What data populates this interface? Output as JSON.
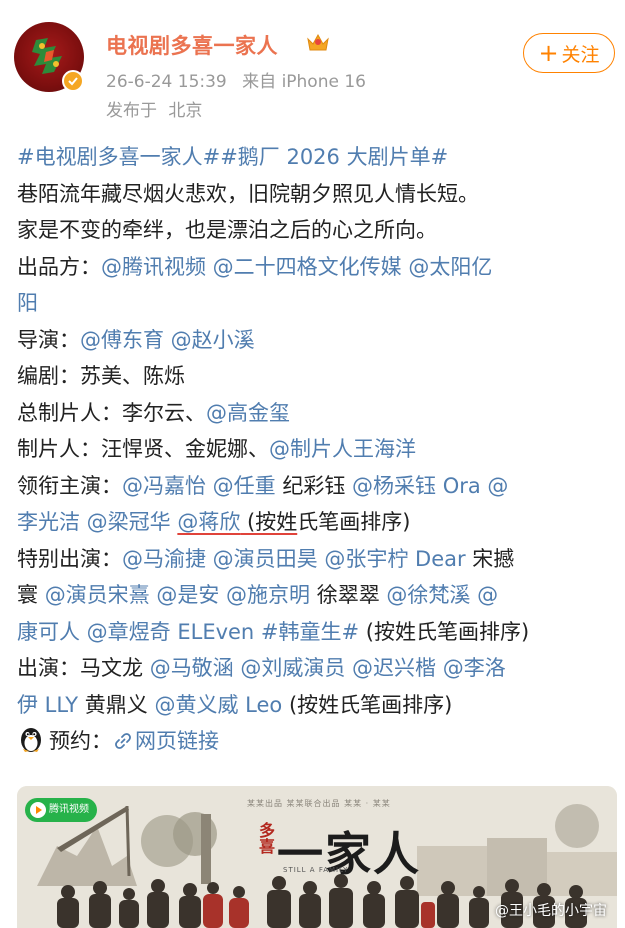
{
  "header": {
    "username": "电视剧多喜一家人",
    "timestamp": "26-6-24 15:39",
    "source_prefix": "来自",
    "device": "iPhone 16",
    "location_prefix": "发布于",
    "location": "北京",
    "follow_label": "关注",
    "follow_plus": "+"
  },
  "post": {
    "hashtags": "#电视剧多喜一家人##鹅厂 2026 大剧片单#",
    "line1": "巷陌流年藏尽烟火悲欢，旧院朝夕照见人情长短。",
    "line2": "家是不变的牵绊，也是漂泊之后的心之所向。",
    "producer_label": "出品方：",
    "producers": "@腾讯视频 @二十四格文化传媒 @太阳亿",
    "producers_cont": "阳",
    "director_label": "导演：",
    "directors": "@傅东育 @赵小溪",
    "writer_label": "编剧：",
    "writers": "苏美、陈烁",
    "chief_producer_label": "总制片人：",
    "chief_producer_plain": "李尔云、",
    "chief_producer_link": "@高金玺",
    "producer2_label": "制片人：",
    "producer2_plain": "汪悍贤、金妮娜、",
    "producer2_link": "@制片人王海洋",
    "lead_label": "领衔主演：",
    "lead_a": "@冯嘉怡 @任重",
    "lead_b": " 纪彩钰 ",
    "lead_c": "@杨采钰 Ora @",
    "lead2_a": "李光洁 @梁冠华 ",
    "lead2_underlined": "@蒋欣",
    "lead2_note_underlined": " (按姓",
    "lead2_note_rest": "氏笔画排序)",
    "special_label": "特别出演：",
    "special_a": "@马渝捷 @演员田昊 @张宇柠 Dear",
    "special_b": " 宋撼",
    "special2_a": "寰 ",
    "special2_b": "@演员宋熹 @是安 @施京明",
    "special2_c": " 徐翠翠 ",
    "special2_d": "@徐梵溪 @",
    "special3_a": "康可人 @章煜奇 ELEven #韩童生#",
    "special3_b": " (按姓氏笔画排序)",
    "cast_label": "出演：",
    "cast_a": "马文龙 ",
    "cast_b": "@马敬涵 @刘威演员 @迟兴楷 @李洛",
    "cast2_a": "伊 LLY",
    "cast2_b": " 黄鼎义 ",
    "cast2_c": "@黄义威 Leo",
    "cast2_d": " (按姓氏笔画排序)",
    "booking_label": "预约：",
    "booking_link": "网页链接"
  },
  "poster": {
    "platform_badge": "腾讯视频",
    "title": "一家人",
    "title_side": "多喜",
    "subtitle": "STILL A FAMILY",
    "credits": "某某出品 某某联合出品 某某 · 某某",
    "watermark": "@王小毛的小宇宙"
  },
  "colors": {
    "link": "#507daf",
    "username": "#eb7350",
    "follow": "#ff8200",
    "meta": "#999999",
    "underline": "#e0433a"
  },
  "icons": [
    "avatar",
    "verified-badge-icon",
    "crown-icon",
    "penguin-icon",
    "link-icon",
    "tencent-video-logo"
  ]
}
